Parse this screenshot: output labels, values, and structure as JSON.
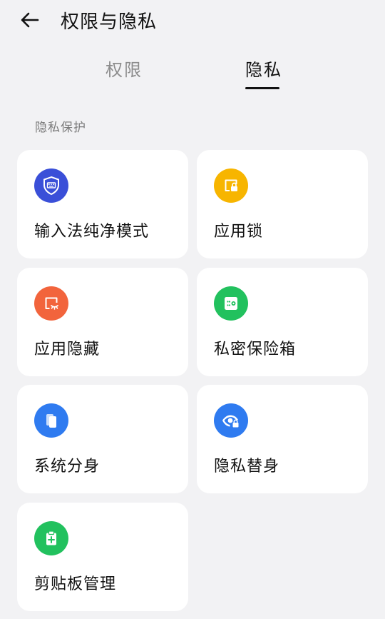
{
  "header": {
    "title": "权限与隐私"
  },
  "tabs": [
    {
      "label": "权限",
      "active": false
    },
    {
      "label": "隐私",
      "active": true
    }
  ],
  "section": {
    "label": "隐私保护"
  },
  "cards": [
    {
      "label": "输入法纯净模式",
      "icon": "keyboard-shield-icon",
      "color": "#3a4fd8"
    },
    {
      "label": "应用锁",
      "icon": "app-lock-icon",
      "color": "#f7b500"
    },
    {
      "label": "应用隐藏",
      "icon": "app-hide-icon",
      "color": "#f2643c"
    },
    {
      "label": "私密保险箱",
      "icon": "safe-icon",
      "color": "#22c15e"
    },
    {
      "label": "系统分身",
      "icon": "system-clone-icon",
      "color": "#2f7bf0"
    },
    {
      "label": "隐私替身",
      "icon": "privacy-eye-icon",
      "color": "#2f7bf0"
    },
    {
      "label": "剪贴板管理",
      "icon": "clipboard-icon",
      "color": "#22c15e"
    }
  ]
}
